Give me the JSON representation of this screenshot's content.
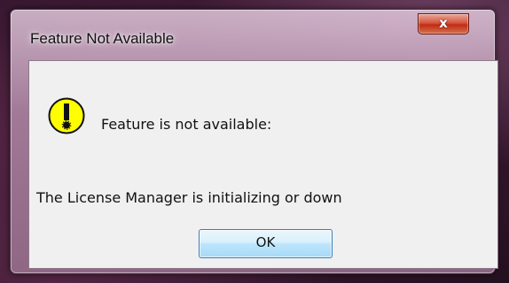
{
  "dialog": {
    "title": "Feature Not Available",
    "close_label": "x",
    "icon": "warning-exclamation-icon",
    "message": "Feature is not available:",
    "detail": "The License Manager is initializing or down",
    "ok_label": "OK"
  },
  "colors": {
    "warning_icon_fill": "#ffff00",
    "ok_button_border": "#3c7fb1",
    "close_button_red": "#c02c14"
  }
}
